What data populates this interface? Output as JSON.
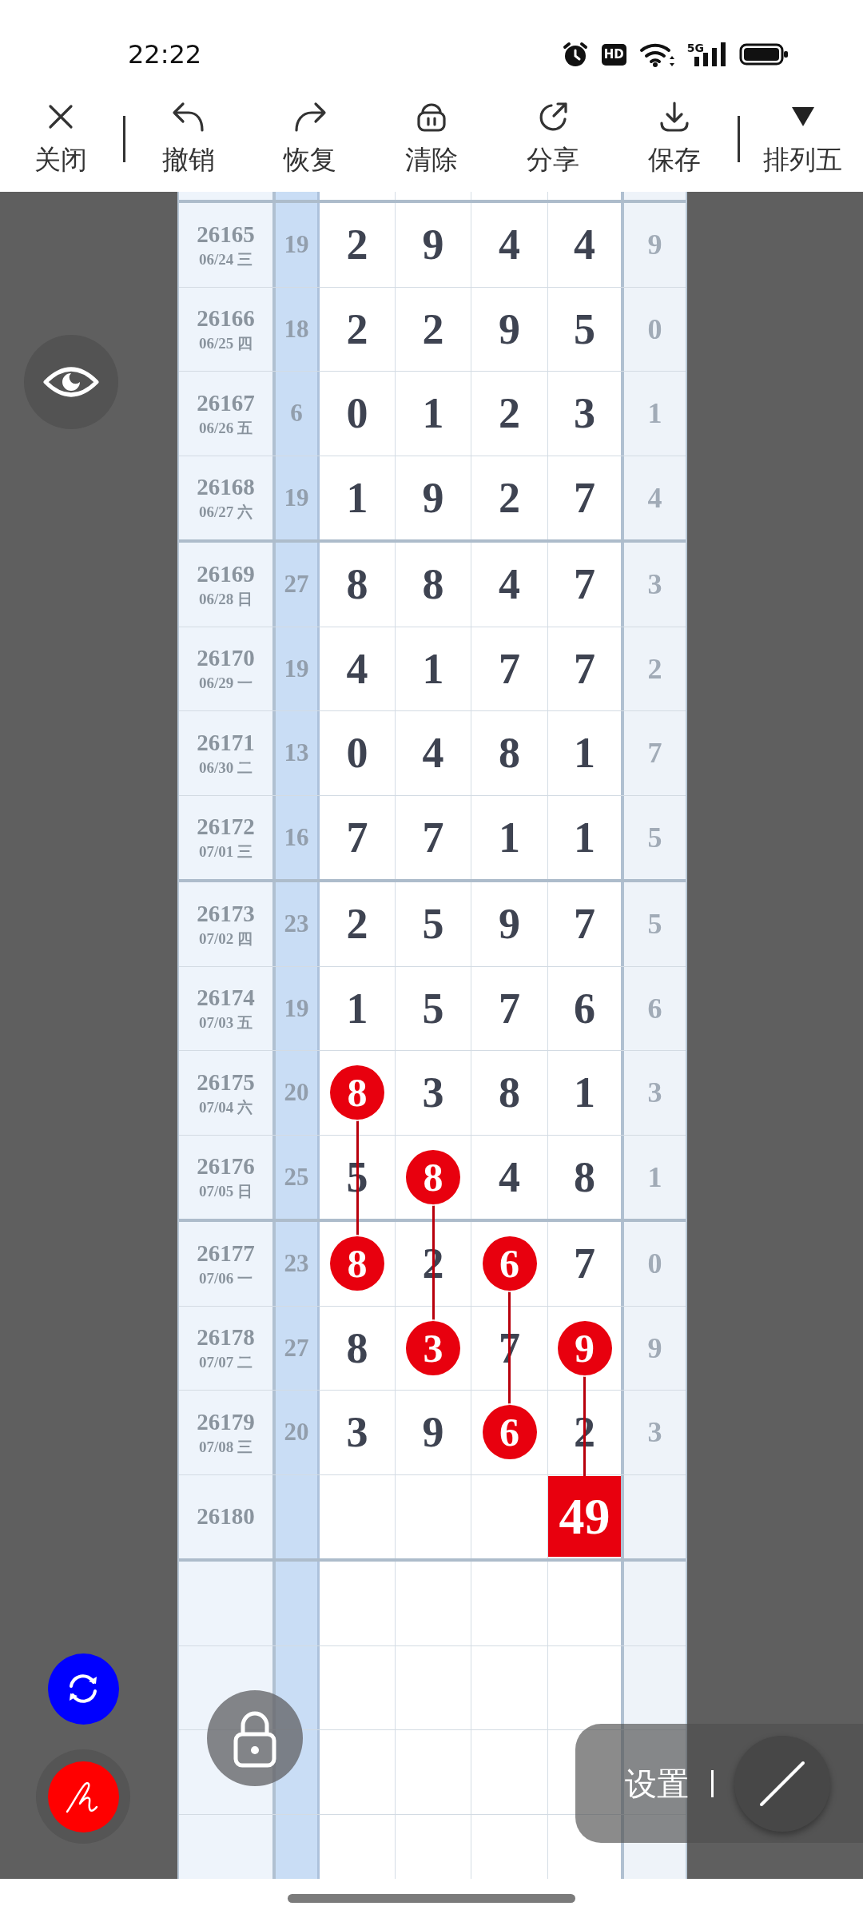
{
  "status_bar": {
    "time": "22:22",
    "hd_badge": "HD",
    "network": "5G"
  },
  "toolbar": {
    "groups": [
      [
        {
          "kind": "close",
          "label": "关闭"
        }
      ],
      [
        {
          "kind": "undo",
          "label": "撤销"
        },
        {
          "kind": "redo",
          "label": "恢复"
        },
        {
          "kind": "clear",
          "label": "清除"
        },
        {
          "kind": "share",
          "label": "分享"
        },
        {
          "kind": "save",
          "label": "保存"
        }
      ],
      [
        {
          "kind": "dropdown",
          "label": "排列五"
        }
      ]
    ]
  },
  "table": {
    "rows": [
      {
        "number": "26165",
        "date": "06/24 三",
        "column_2": "19",
        "digits": [
          {
            "kind": "plain",
            "value": "2"
          },
          {
            "kind": "plain",
            "value": "9"
          },
          {
            "kind": "plain",
            "value": "4"
          },
          {
            "kind": "plain",
            "value": "4"
          }
        ],
        "column_7": "9"
      },
      {
        "number": "26166",
        "date": "06/25 四",
        "column_2": "18",
        "digits": [
          {
            "kind": "plain",
            "value": "2"
          },
          {
            "kind": "plain",
            "value": "2"
          },
          {
            "kind": "plain",
            "value": "9"
          },
          {
            "kind": "plain",
            "value": "5"
          }
        ],
        "column_7": "0"
      },
      {
        "number": "26167",
        "date": "06/26 五",
        "column_2": "6",
        "digits": [
          {
            "kind": "plain",
            "value": "0"
          },
          {
            "kind": "plain",
            "value": "1"
          },
          {
            "kind": "plain",
            "value": "2"
          },
          {
            "kind": "plain",
            "value": "3"
          }
        ],
        "column_7": "1"
      },
      {
        "number": "26168",
        "date": "06/27 六",
        "column_2": "19",
        "digits": [
          {
            "kind": "plain",
            "value": "1"
          },
          {
            "kind": "plain",
            "value": "9"
          },
          {
            "kind": "plain",
            "value": "2"
          },
          {
            "kind": "plain",
            "value": "7"
          }
        ],
        "column_7": "4"
      },
      {
        "number": "26169",
        "date": "06/28 日",
        "column_2": "27",
        "digits": [
          {
            "kind": "plain",
            "value": "8"
          },
          {
            "kind": "plain",
            "value": "8"
          },
          {
            "kind": "plain",
            "value": "4"
          },
          {
            "kind": "plain",
            "value": "7"
          }
        ],
        "column_7": "3"
      },
      {
        "number": "26170",
        "date": "06/29 一",
        "column_2": "19",
        "digits": [
          {
            "kind": "plain",
            "value": "4"
          },
          {
            "kind": "plain",
            "value": "1"
          },
          {
            "kind": "plain",
            "value": "7"
          },
          {
            "kind": "plain",
            "value": "7"
          }
        ],
        "column_7": "2"
      },
      {
        "number": "26171",
        "date": "06/30 二",
        "column_2": "13",
        "digits": [
          {
            "kind": "plain",
            "value": "0"
          },
          {
            "kind": "plain",
            "value": "4"
          },
          {
            "kind": "plain",
            "value": "8"
          },
          {
            "kind": "plain",
            "value": "1"
          }
        ],
        "column_7": "7"
      },
      {
        "number": "26172",
        "date": "07/01 三",
        "column_2": "16",
        "digits": [
          {
            "kind": "plain",
            "value": "7"
          },
          {
            "kind": "plain",
            "value": "7"
          },
          {
            "kind": "plain",
            "value": "1"
          },
          {
            "kind": "plain",
            "value": "1"
          }
        ],
        "column_7": "5"
      },
      {
        "number": "26173",
        "date": "07/02 四",
        "column_2": "23",
        "digits": [
          {
            "kind": "plain",
            "value": "2"
          },
          {
            "kind": "plain",
            "value": "5"
          },
          {
            "kind": "plain",
            "value": "9"
          },
          {
            "kind": "plain",
            "value": "7"
          }
        ],
        "column_7": "5"
      },
      {
        "number": "26174",
        "date": "07/03 五",
        "column_2": "19",
        "digits": [
          {
            "kind": "plain",
            "value": "1"
          },
          {
            "kind": "plain",
            "value": "5"
          },
          {
            "kind": "plain",
            "value": "7"
          },
          {
            "kind": "plain",
            "value": "6"
          }
        ],
        "column_7": "6"
      },
      {
        "number": "26175",
        "date": "07/04 六",
        "column_2": "20",
        "digits": [
          {
            "kind": "circle",
            "value": "8"
          },
          {
            "kind": "plain",
            "value": "3"
          },
          {
            "kind": "plain",
            "value": "8"
          },
          {
            "kind": "plain",
            "value": "1"
          }
        ],
        "column_7": "3"
      },
      {
        "number": "26176",
        "date": "07/05 日",
        "column_2": "25",
        "digits": [
          {
            "kind": "plain",
            "value": "5"
          },
          {
            "kind": "circle",
            "value": "8"
          },
          {
            "kind": "plain",
            "value": "4"
          },
          {
            "kind": "plain",
            "value": "8"
          }
        ],
        "column_7": "1"
      },
      {
        "number": "26177",
        "date": "07/06 一",
        "column_2": "23",
        "digits": [
          {
            "kind": "circle",
            "value": "8"
          },
          {
            "kind": "plain",
            "value": "2"
          },
          {
            "kind": "circle",
            "value": "6"
          },
          {
            "kind": "plain",
            "value": "7"
          }
        ],
        "column_7": "0"
      },
      {
        "number": "26178",
        "date": "07/07 二",
        "column_2": "27",
        "digits": [
          {
            "kind": "plain",
            "value": "8"
          },
          {
            "kind": "circle",
            "value": "3"
          },
          {
            "kind": "plain",
            "value": "7"
          },
          {
            "kind": "circle",
            "value": "9"
          }
        ],
        "column_7": "9"
      },
      {
        "number": "26179",
        "date": "07/08 三",
        "column_2": "20",
        "digits": [
          {
            "kind": "plain",
            "value": "3"
          },
          {
            "kind": "plain",
            "value": "9"
          },
          {
            "kind": "circle",
            "value": "6"
          },
          {
            "kind": "plain",
            "value": "2"
          }
        ],
        "column_7": "3"
      },
      {
        "number": "26180",
        "digits": [
          {
            "kind": "blank"
          },
          {
            "kind": "blank"
          },
          {
            "kind": "blank"
          },
          {
            "kind": "square",
            "value": "49"
          }
        ]
      }
    ]
  },
  "floating_buttons": [
    {
      "kind": "eye",
      "selected": false
    },
    {
      "kind": "refresh",
      "selected": false
    },
    {
      "kind": "pen",
      "selected": true
    },
    {
      "kind": "lock",
      "selected": false
    }
  ],
  "settings_panel": {
    "label": "设置"
  }
}
